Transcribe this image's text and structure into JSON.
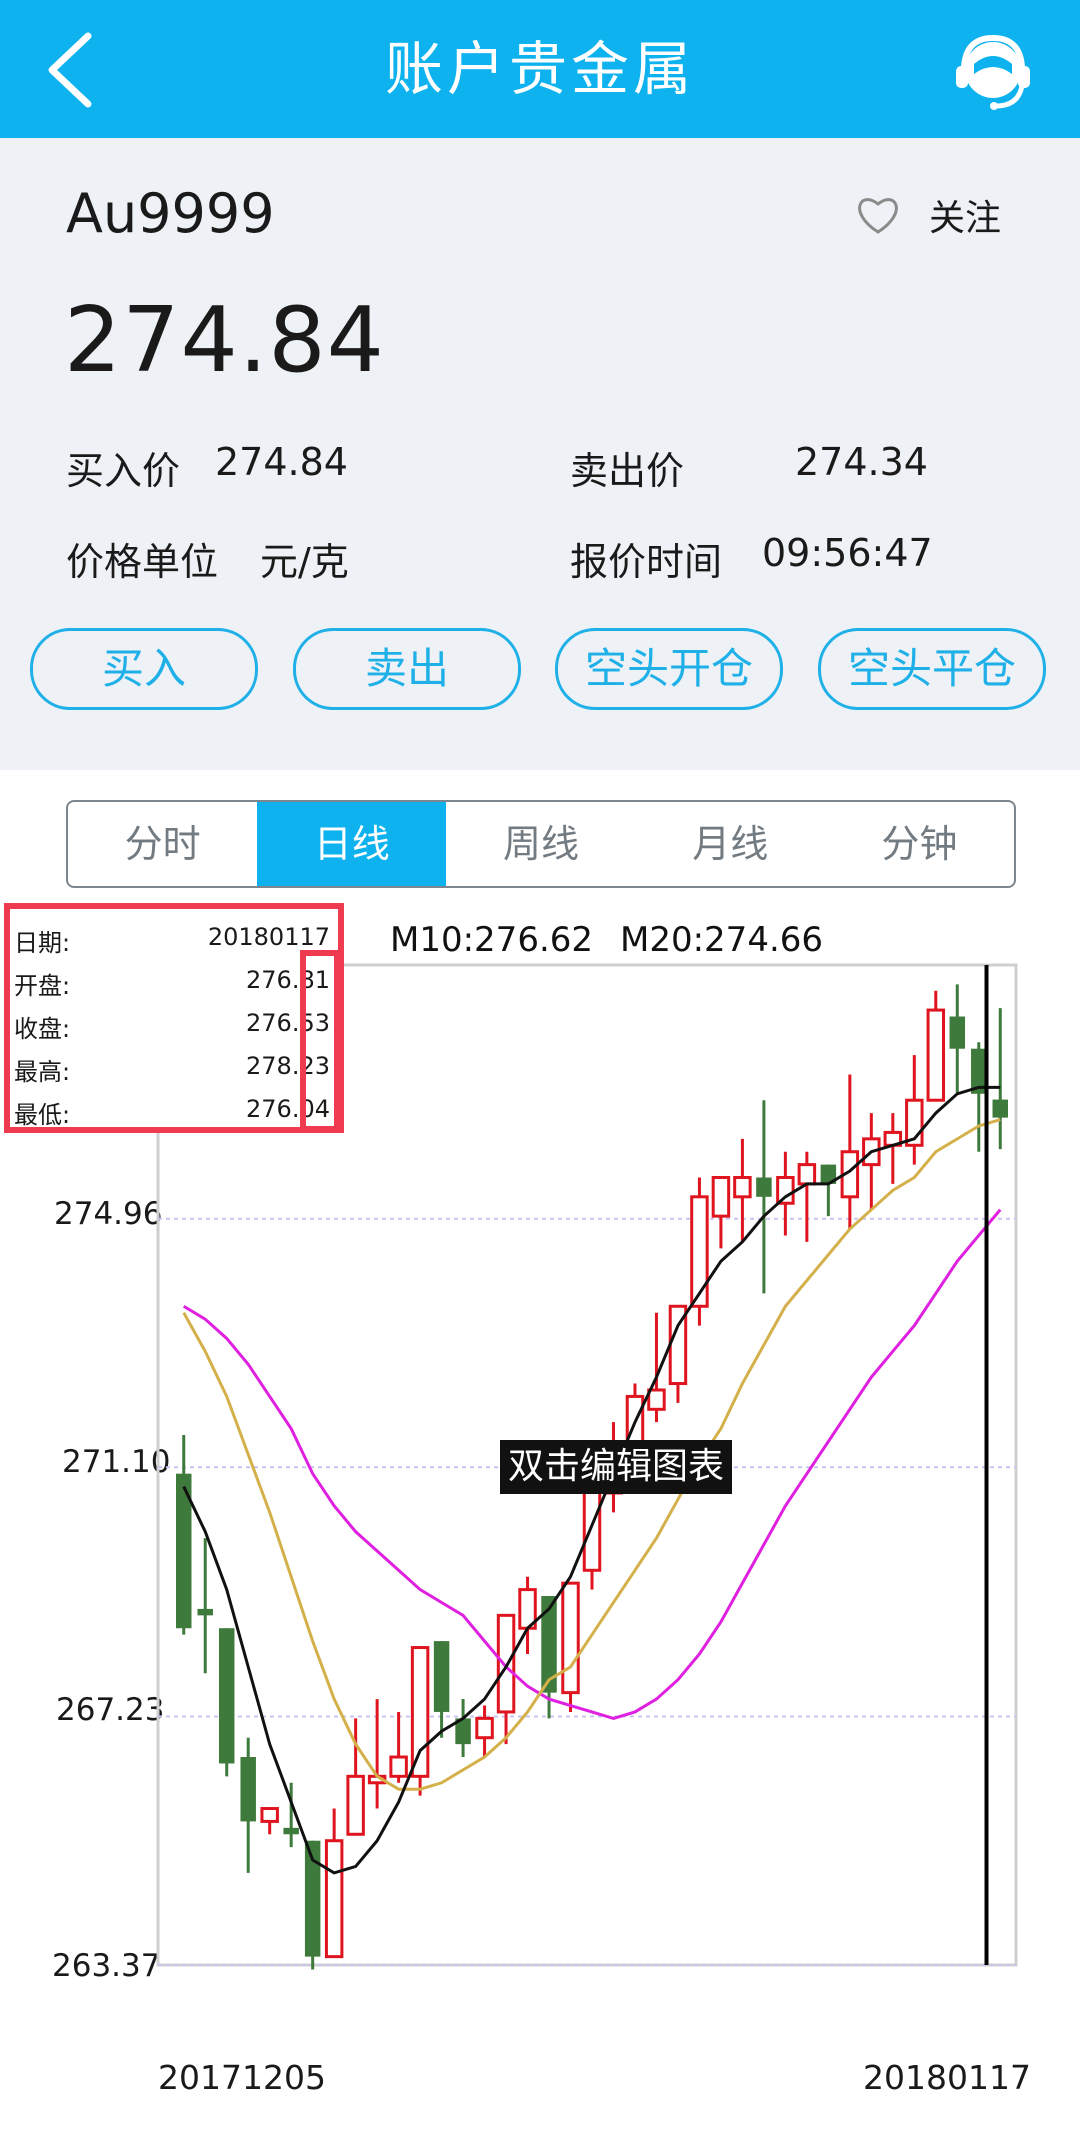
{
  "nav": {
    "title": "账户贵金属",
    "back_icon": "chevron-left-icon",
    "service_icon": "customer-service-icon"
  },
  "product": {
    "symbol": "Au9999",
    "follow_label": "关注",
    "follow_icon": "heart-outline-icon",
    "price": "274.84"
  },
  "quote": {
    "buy_label": "买入价",
    "buy_value": "274.84",
    "sell_label": "卖出价",
    "sell_value": "274.34",
    "unit_label": "价格单位",
    "unit_value": "元/克",
    "time_label": "报价时间",
    "time_value": "09:56:47"
  },
  "actions": [
    "买入",
    "卖出",
    "空头开仓",
    "空头平仓"
  ],
  "tabs": [
    {
      "label": "分时",
      "active": false
    },
    {
      "label": "日线",
      "active": true
    },
    {
      "label": "周线",
      "active": false
    },
    {
      "label": "月线",
      "active": false
    },
    {
      "label": "分钟",
      "active": false
    }
  ],
  "overlay_text": "双击编辑图表",
  "popup": {
    "rows": [
      {
        "key": "日期:",
        "value": "20180117"
      },
      {
        "key": "开盘:",
        "value": "276.81"
      },
      {
        "key": "收盘:",
        "value": "276.53"
      },
      {
        "key": "最高:",
        "value": "278.23"
      },
      {
        "key": "最低:",
        "value": "276.04"
      }
    ]
  },
  "colors": {
    "brand": "#0db2ee",
    "up": "#e0141e",
    "down": "#3e7a3c",
    "ma10": "#111111",
    "ma20": "#d4b04a",
    "ma30": "#e020e0",
    "highlight": "#ef3b4f"
  },
  "chart_data": {
    "type": "candlestick",
    "ma_labels": [
      {
        "label": "M10:276.62",
        "color": "#111111"
      },
      {
        "label": "M20:274.66",
        "color": "#d4b04a"
      }
    ],
    "y_ticks": [
      "274.96",
      "271.10",
      "267.23",
      "263.37"
    ],
    "y_tick_values": [
      274.96,
      271.1,
      267.23,
      263.37
    ],
    "ylim": [
      263.37,
      278.9
    ],
    "x_labels": [
      "20171205",
      "20180117"
    ],
    "candles": [
      {
        "o": 271.0,
        "c": 268.6,
        "h": 271.6,
        "l": 268.5
      },
      {
        "o": 268.9,
        "c": 268.8,
        "h": 270.0,
        "l": 267.9
      },
      {
        "o": 268.6,
        "c": 266.5,
        "h": 268.6,
        "l": 266.3
      },
      {
        "o": 266.6,
        "c": 265.6,
        "h": 266.9,
        "l": 264.8
      },
      {
        "o": 265.6,
        "c": 265.8,
        "h": 265.8,
        "l": 265.4
      },
      {
        "o": 265.5,
        "c": 265.4,
        "h": 266.2,
        "l": 265.2
      },
      {
        "o": 265.3,
        "c": 263.5,
        "h": 265.3,
        "l": 263.3
      },
      {
        "o": 263.5,
        "c": 265.3,
        "h": 265.8,
        "l": 263.5
      },
      {
        "o": 265.4,
        "c": 266.3,
        "h": 267.2,
        "l": 265.4
      },
      {
        "o": 266.2,
        "c": 266.3,
        "h": 267.5,
        "l": 265.8
      },
      {
        "o": 266.3,
        "c": 266.6,
        "h": 267.3,
        "l": 266.2
      },
      {
        "o": 266.3,
        "c": 268.3,
        "h": 268.3,
        "l": 266.0
      },
      {
        "o": 268.4,
        "c": 267.3,
        "h": 268.4,
        "l": 266.9
      },
      {
        "o": 267.2,
        "c": 266.8,
        "h": 267.5,
        "l": 266.6
      },
      {
        "o": 266.9,
        "c": 267.2,
        "h": 267.4,
        "l": 266.6
      },
      {
        "o": 267.3,
        "c": 268.8,
        "h": 268.8,
        "l": 266.8
      },
      {
        "o": 268.6,
        "c": 269.2,
        "h": 269.4,
        "l": 268.2
      },
      {
        "o": 269.1,
        "c": 267.6,
        "h": 269.1,
        "l": 267.2
      },
      {
        "o": 267.6,
        "c": 269.3,
        "h": 269.3,
        "l": 267.3
      },
      {
        "o": 269.5,
        "c": 270.8,
        "h": 271.1,
        "l": 269.2
      },
      {
        "o": 270.7,
        "c": 271.5,
        "h": 271.8,
        "l": 270.4
      },
      {
        "o": 271.5,
        "c": 272.2,
        "h": 272.4,
        "l": 271.0
      },
      {
        "o": 272.0,
        "c": 272.3,
        "h": 273.5,
        "l": 271.8
      },
      {
        "o": 272.4,
        "c": 273.6,
        "h": 273.6,
        "l": 272.1
      },
      {
        "o": 273.6,
        "c": 275.3,
        "h": 275.6,
        "l": 273.3
      },
      {
        "o": 275.0,
        "c": 275.6,
        "h": 275.6,
        "l": 274.5
      },
      {
        "o": 275.3,
        "c": 275.6,
        "h": 276.2,
        "l": 274.6
      },
      {
        "o": 275.6,
        "c": 275.3,
        "h": 276.8,
        "l": 273.8
      },
      {
        "o": 275.2,
        "c": 275.6,
        "h": 276.0,
        "l": 274.7
      },
      {
        "o": 275.5,
        "c": 275.8,
        "h": 276.0,
        "l": 274.6
      },
      {
        "o": 275.8,
        "c": 275.5,
        "h": 275.8,
        "l": 275.0
      },
      {
        "o": 275.3,
        "c": 276.0,
        "h": 277.2,
        "l": 274.8
      },
      {
        "o": 275.8,
        "c": 276.2,
        "h": 276.6,
        "l": 275.1
      },
      {
        "o": 276.1,
        "c": 276.3,
        "h": 276.6,
        "l": 275.5
      },
      {
        "o": 276.1,
        "c": 276.8,
        "h": 277.5,
        "l": 275.8
      },
      {
        "o": 276.8,
        "c": 278.2,
        "h": 278.5,
        "l": 276.8
      },
      {
        "o": 278.1,
        "c": 277.6,
        "h": 278.6,
        "l": 276.9
      },
      {
        "o": 277.6,
        "c": 276.9,
        "h": 277.7,
        "l": 276.0
      },
      {
        "o": 276.81,
        "c": 276.53,
        "h": 278.23,
        "l": 276.04
      }
    ],
    "ma10": [
      270.8,
      270.1,
      269.2,
      268.0,
      266.8,
      265.9,
      265.0,
      264.8,
      264.9,
      265.3,
      265.9,
      266.7,
      267.0,
      267.2,
      267.5,
      268.0,
      268.6,
      268.9,
      269.4,
      270.2,
      271.0,
      271.8,
      272.5,
      273.3,
      273.8,
      274.3,
      274.6,
      275.0,
      275.3,
      275.5,
      275.5,
      275.7,
      276.0,
      276.1,
      276.2,
      276.6,
      276.9,
      277.0,
      277.0
    ],
    "ma20": [
      273.5,
      272.9,
      272.2,
      271.3,
      270.4,
      269.4,
      268.4,
      267.5,
      266.8,
      266.3,
      266.1,
      266.1,
      266.2,
      266.4,
      266.6,
      266.9,
      267.3,
      267.8,
      268.0,
      268.5,
      269.0,
      269.5,
      270.0,
      270.6,
      271.2,
      271.7,
      272.4,
      273.0,
      273.6,
      274.0,
      274.4,
      274.8,
      275.1,
      275.4,
      275.6,
      276.0,
      276.2,
      276.4,
      276.5
    ],
    "ma30": [
      273.6,
      273.4,
      273.1,
      272.7,
      272.2,
      271.7,
      271.0,
      270.5,
      270.1,
      269.8,
      269.5,
      269.2,
      269.0,
      268.8,
      268.4,
      268.0,
      267.7,
      267.5,
      267.4,
      267.3,
      267.2,
      267.3,
      267.5,
      267.8,
      268.2,
      268.7,
      269.3,
      269.9,
      270.5,
      271.0,
      271.5,
      272.0,
      272.5,
      272.9,
      273.3,
      273.8,
      274.3,
      274.7,
      275.1
    ]
  }
}
